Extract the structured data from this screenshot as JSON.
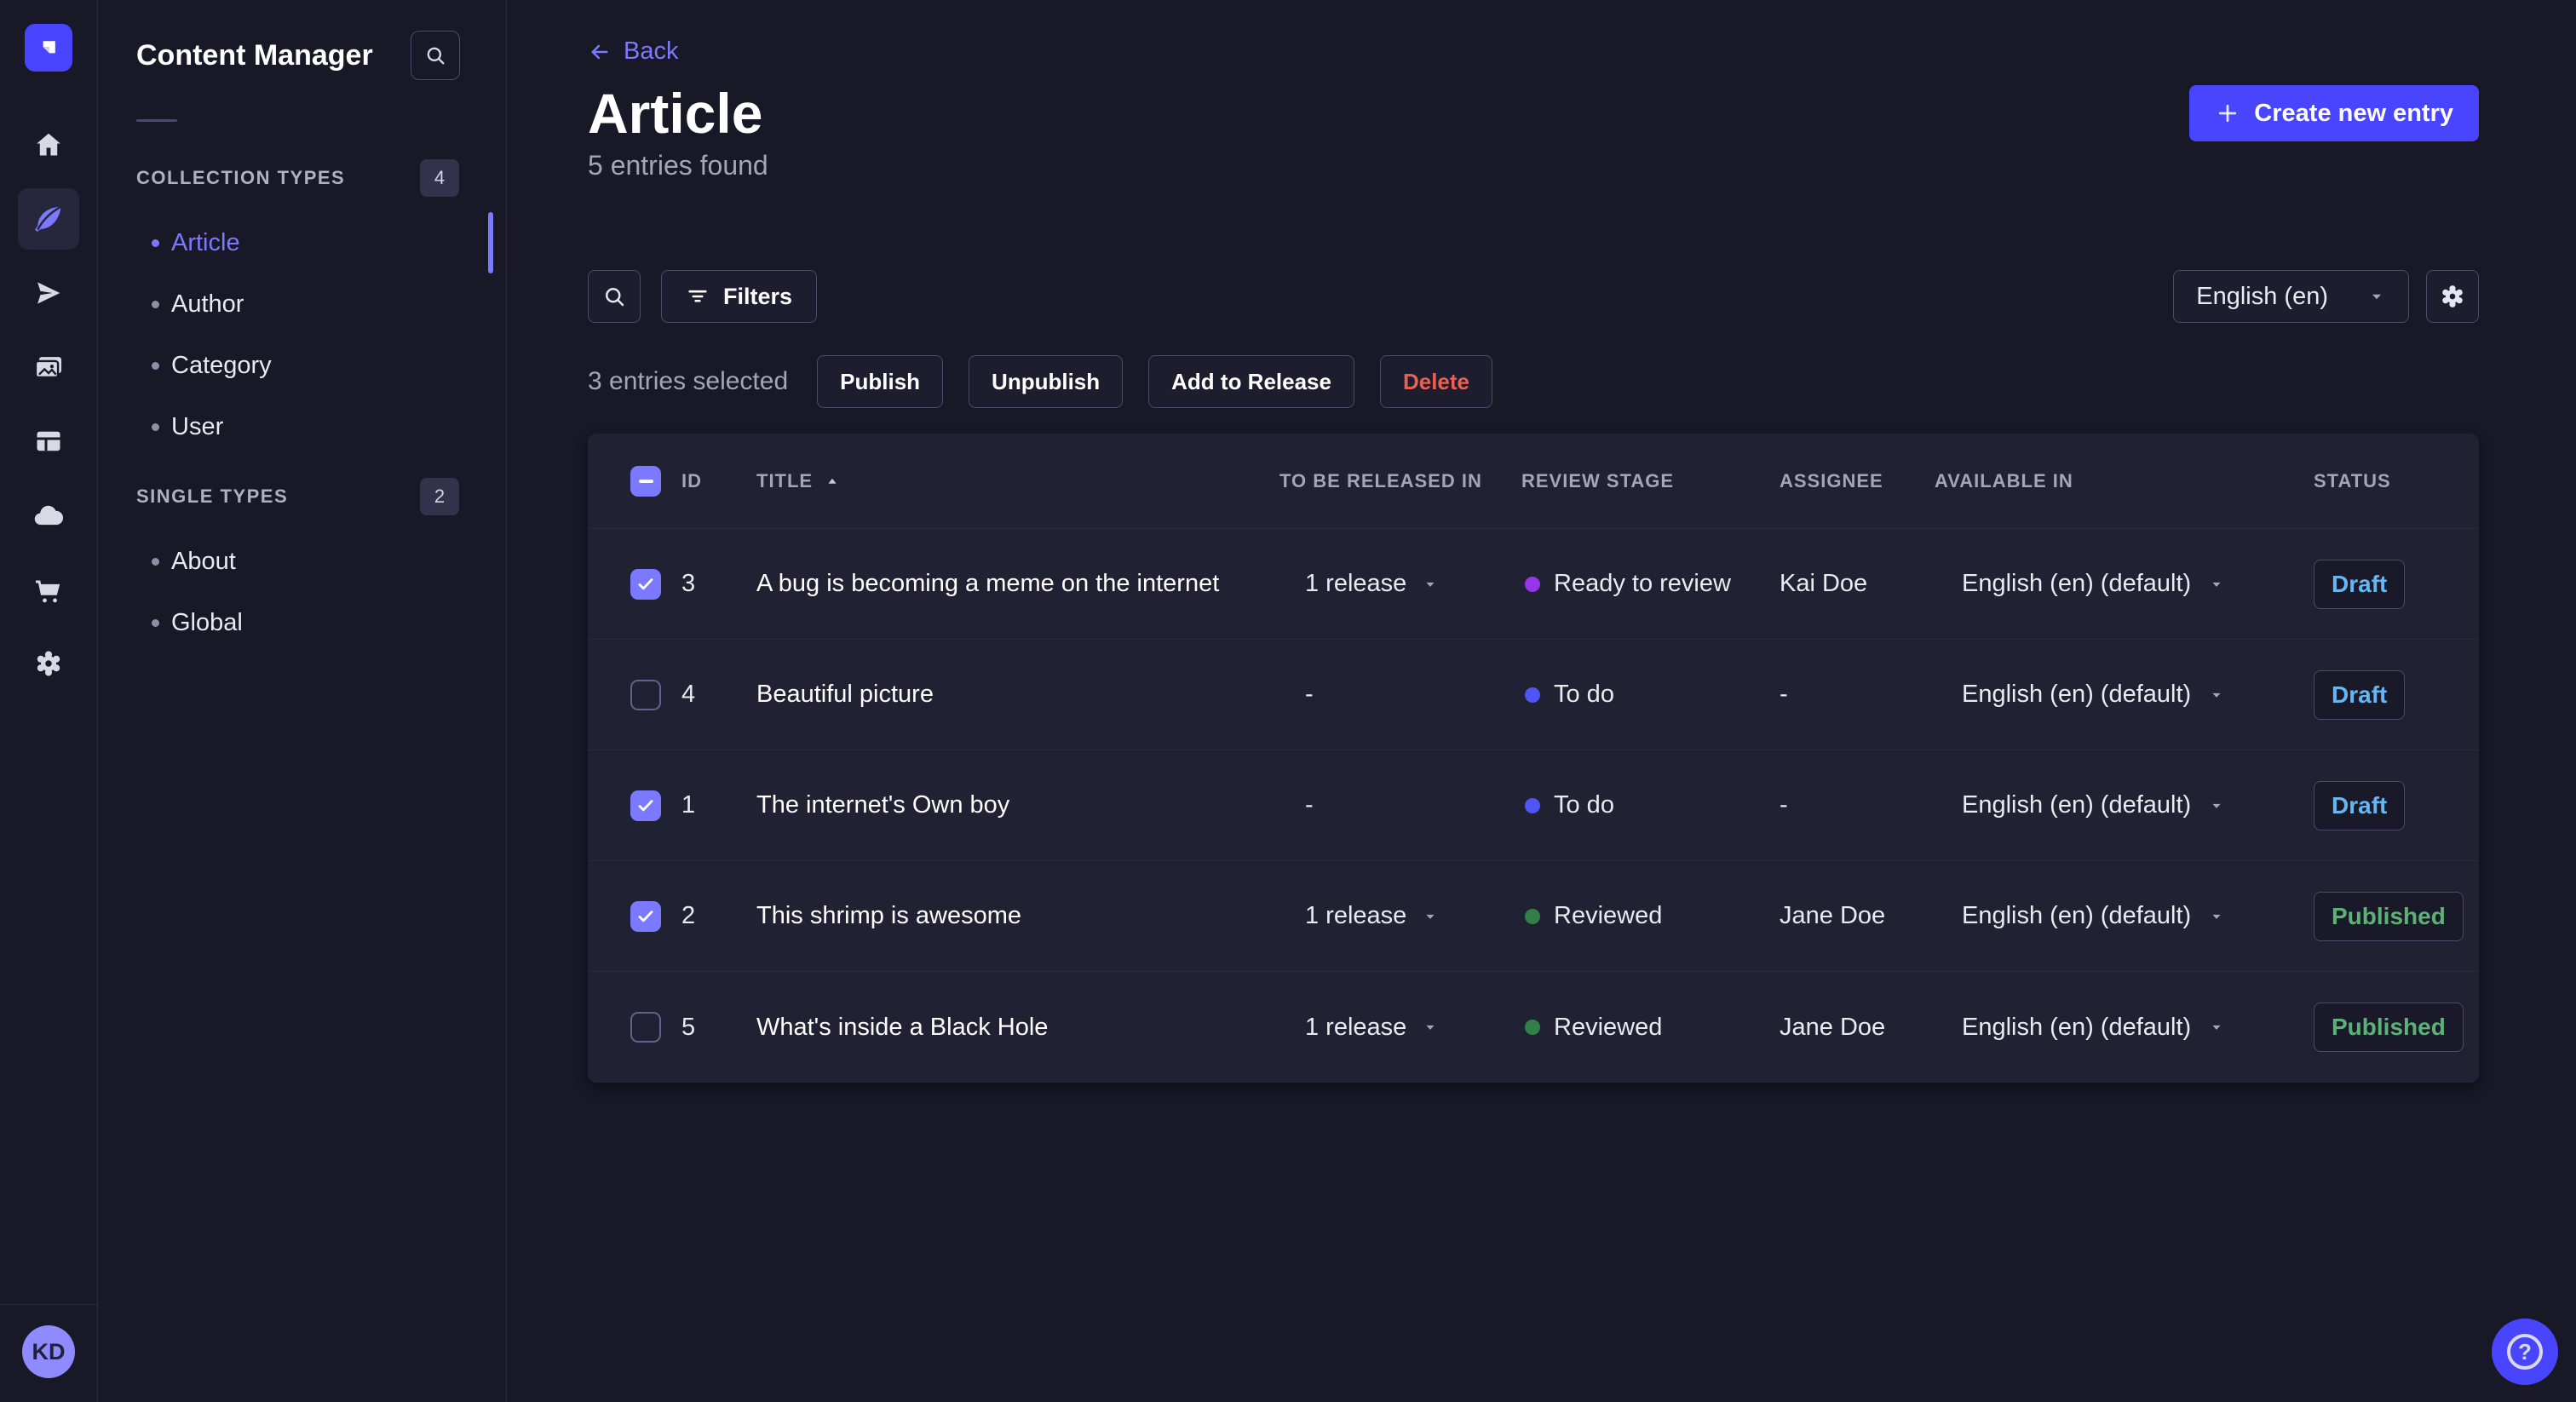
{
  "colors": {
    "accent": "#4945ff",
    "accent_light": "#7b79ff",
    "draft_text": "#66b7f1",
    "published_text": "#5cb176",
    "danger_text": "#ee5e52",
    "stage_ready_to_review": "#9736e8",
    "stage_to_do": "#4f54f5",
    "stage_reviewed": "#328048"
  },
  "rail": {
    "logo_icon": "strapi-logo",
    "items": [
      {
        "icon": "home-icon",
        "active": false
      },
      {
        "icon": "feather-icon",
        "active": true
      },
      {
        "icon": "paper-plane-icon",
        "active": false
      },
      {
        "icon": "media-gallery-icon",
        "active": false
      },
      {
        "icon": "layout-icon",
        "active": false
      },
      {
        "icon": "cloud-icon",
        "active": false
      },
      {
        "icon": "cart-icon",
        "active": false
      },
      {
        "icon": "gear-icon",
        "active": false
      }
    ],
    "avatar_initials": "KD"
  },
  "subnav": {
    "title": "Content Manager",
    "search_icon": "search-icon",
    "sections": [
      {
        "label": "COLLECTION TYPES",
        "badge": "4",
        "items": [
          {
            "label": "Article",
            "active": true
          },
          {
            "label": "Author",
            "active": false
          },
          {
            "label": "Category",
            "active": false
          },
          {
            "label": "User",
            "active": false
          }
        ]
      },
      {
        "label": "SINGLE TYPES",
        "badge": "2",
        "items": [
          {
            "label": "About",
            "active": false
          },
          {
            "label": "Global",
            "active": false
          }
        ]
      }
    ]
  },
  "header": {
    "back_label": "Back",
    "title": "Article",
    "subtitle": "5 entries found",
    "create_label": "Create new entry"
  },
  "toolbar": {
    "filters_label": "Filters",
    "locale": "English (en)"
  },
  "selection": {
    "summary": "3 entries selected",
    "actions": [
      {
        "label": "Publish",
        "variant": "default"
      },
      {
        "label": "Unpublish",
        "variant": "default"
      },
      {
        "label": "Add to Release",
        "variant": "default"
      },
      {
        "label": "Delete",
        "variant": "danger"
      }
    ]
  },
  "table": {
    "headers": {
      "id": "ID",
      "title": "TITLE",
      "release": "TO BE RELEASED IN",
      "stage": "REVIEW STAGE",
      "assignee": "ASSIGNEE",
      "available": "AVAILABLE IN",
      "status": "STATUS"
    },
    "sort": {
      "column": "TITLE",
      "direction": "asc"
    },
    "rows": [
      {
        "checked": true,
        "id": "3",
        "title": "A bug is becoming a meme on the internet",
        "release": "1 release",
        "stage": "Ready to review",
        "stage_color": "#9736e8",
        "assignee": "Kai Doe",
        "available": "English (en) (default)",
        "status": "Draft"
      },
      {
        "checked": false,
        "id": "4",
        "title": "Beautiful picture",
        "release": "-",
        "stage": "To do",
        "stage_color": "#4f54f5",
        "assignee": "-",
        "available": "English (en) (default)",
        "status": "Draft"
      },
      {
        "checked": true,
        "id": "1",
        "title": "The internet's Own boy",
        "release": "-",
        "stage": "To do",
        "stage_color": "#4f54f5",
        "assignee": "-",
        "available": "English (en) (default)",
        "status": "Draft"
      },
      {
        "checked": true,
        "id": "2",
        "title": "This shrimp is awesome",
        "release": "1 release",
        "stage": "Reviewed",
        "stage_color": "#328048",
        "assignee": "Jane Doe",
        "available": "English (en) (default)",
        "status": "Published"
      },
      {
        "checked": false,
        "id": "5",
        "title": "What's inside a Black Hole",
        "release": "1 release",
        "stage": "Reviewed",
        "stage_color": "#328048",
        "assignee": "Jane Doe",
        "available": "English (en) (default)",
        "status": "Published"
      }
    ]
  },
  "help": {
    "icon": "question-mark-icon"
  }
}
